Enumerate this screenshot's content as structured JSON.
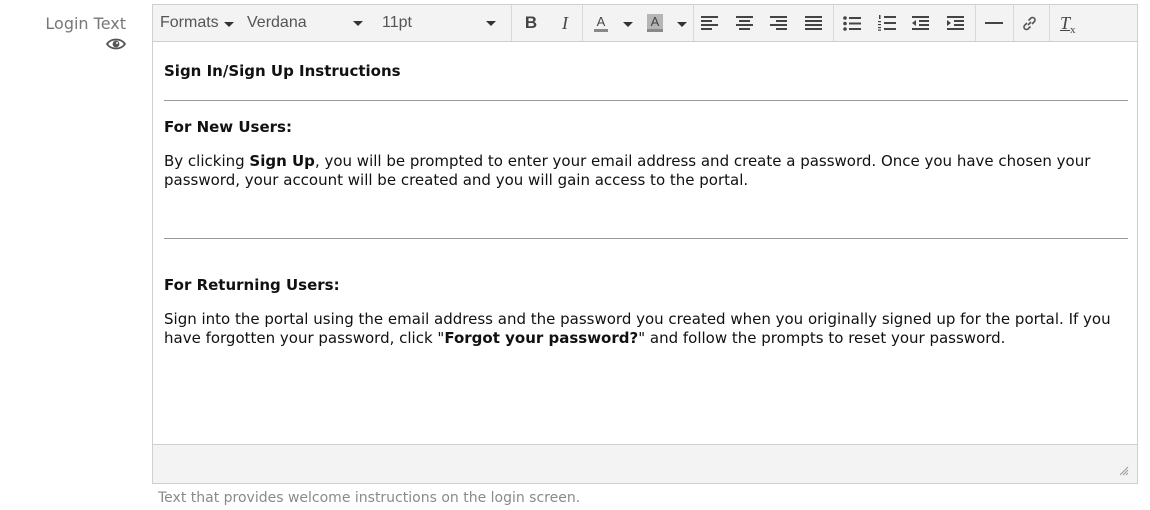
{
  "field": {
    "label": "Login Text",
    "help_text": "Text that provides welcome instructions on the login screen."
  },
  "toolbar": {
    "formats_label": "Formats",
    "font_family": "Verdana",
    "font_size": "11pt",
    "bold_label": "B",
    "italic_label": "I",
    "text_color_label": "A",
    "bg_color_label": "A",
    "clear_format_label": "T",
    "clear_format_sub": "x"
  },
  "content": {
    "title": "Sign In/Sign Up Instructions",
    "new_users_heading": "For New Users:",
    "new_users_body_pre": "By clicking ",
    "new_users_body_bold": "Sign Up",
    "new_users_body_post": ", you will be prompted to enter your email address and create a password. Once you have chosen your password, your account will be created and you will gain access to the portal.",
    "returning_heading": "For Returning Users:",
    "returning_body_pre": "Sign into the portal using the email address and the password you created when you originally signed up for the portal. If you have forgotten your password, click \"",
    "returning_body_bold": "Forgot your password?",
    "returning_body_post": "\" and follow the prompts to reset your password."
  }
}
